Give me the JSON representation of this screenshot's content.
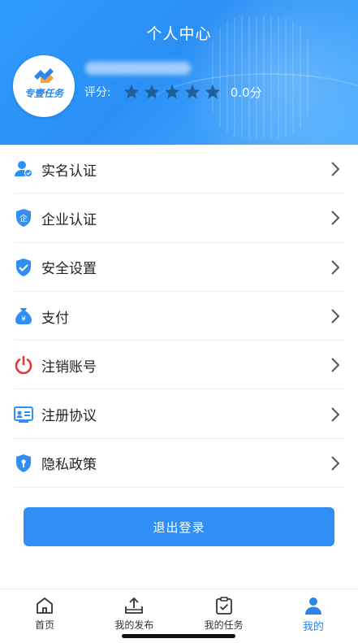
{
  "header": {
    "title": "个人中心",
    "logo_text": "专壹任务",
    "rating_label": "评分:",
    "rating_value": "0.0分",
    "stars_filled": 0,
    "stars_total": 5
  },
  "menu": {
    "items": [
      {
        "label": "实名认证",
        "icon": "user-verify-icon"
      },
      {
        "label": "企业认证",
        "icon": "enterprise-shield-icon"
      },
      {
        "label": "安全设置",
        "icon": "security-shield-icon"
      },
      {
        "label": "支付",
        "icon": "money-bag-icon"
      },
      {
        "label": "注销账号",
        "icon": "power-icon"
      },
      {
        "label": "注册协议",
        "icon": "agreement-card-icon"
      },
      {
        "label": "隐私政策",
        "icon": "privacy-shield-icon"
      }
    ]
  },
  "logout_label": "退出登录",
  "tabbar": {
    "tabs": [
      {
        "label": "首页",
        "icon": "home-icon"
      },
      {
        "label": "我的发布",
        "icon": "publish-icon"
      },
      {
        "label": "我的任务",
        "icon": "task-clipboard-icon"
      },
      {
        "label": "我的",
        "icon": "profile-icon",
        "active": true
      }
    ]
  },
  "colors": {
    "accent": "#2f8ff5",
    "header_blue": "#2a8ff5",
    "power_red": "#e53935",
    "star_dark": "#1f5f9a"
  }
}
